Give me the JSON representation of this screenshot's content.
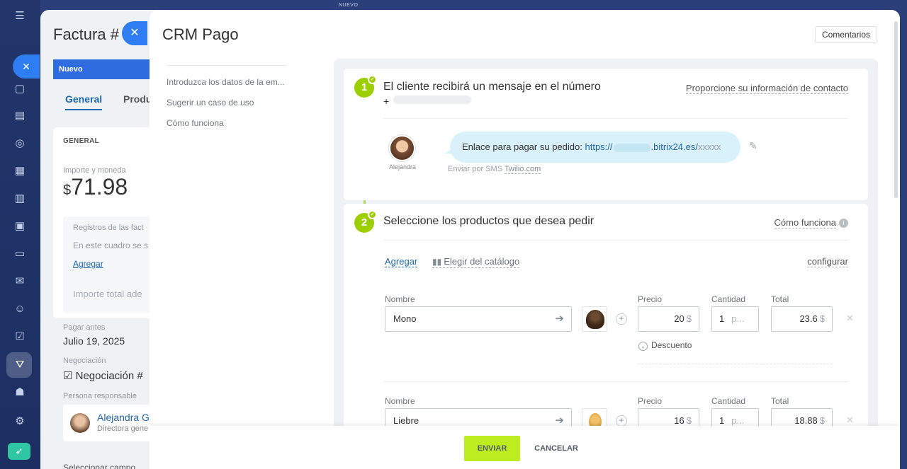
{
  "background": {
    "new_badge": "NUEVO",
    "invoice_title": "Factura #",
    "stage": "Nuevo",
    "tabs": [
      "General",
      "Produ"
    ],
    "card_head": "GENERAL",
    "amount_label": "Importe y moneda",
    "amount_currency": "$",
    "amount_value": "71.98",
    "registers_label": "Registros de las fact",
    "box_text": "En este cuadro se s",
    "add_link": "Agregar",
    "total_label": "Importe total ade",
    "pay_before_label": "Pagar antes",
    "pay_before_value": "Julio 19, 2025",
    "deal_label": "Negociación",
    "deal_value": "Negociación #",
    "responsible_label": "Persona responsable",
    "person_name": "Alejandra G",
    "person_role": "Directora gene",
    "select_field": "Seleccionar campo"
  },
  "slider": {
    "title": "CRM Pago",
    "comments_button": "Comentarios",
    "nav": [
      "Introduzca los datos de la em...",
      "Sugerir un caso de uso",
      "Cómo funciona"
    ]
  },
  "step1": {
    "number": "1",
    "title": "El cliente recibirá un mensaje en el número",
    "phone_prefix": "+",
    "contact_link": "Proporcione su información de contacto",
    "avatar_name": "Alejandra",
    "message_prefix": "Enlace para pagar su pedido:",
    "link_start": "https://",
    "link_domain": ".bitrix24.es/",
    "link_suffix": "xxxxx",
    "sms_prefix": "Enviar por SMS",
    "sms_provider": "Twilio.com"
  },
  "step2": {
    "number": "2",
    "title": "Seleccione los productos que desea pedir",
    "how_link": "Cómo funciona",
    "add_link": "Agregar",
    "catalog_link": "Elegir del catálogo",
    "config_link": "configurar",
    "labels": {
      "name": "Nombre",
      "price": "Precio",
      "qty": "Cantidad",
      "total": "Total"
    },
    "discount_label": "Descuento",
    "products": [
      {
        "name": "Mono",
        "price": "20",
        "currency": "$",
        "qty": "1",
        "unit": "p...",
        "total": "23.6"
      },
      {
        "name": "Liebre",
        "price": "16",
        "currency": "$",
        "qty": "1",
        "unit": "p...",
        "total": "18.88"
      }
    ]
  },
  "footer": {
    "send": "ENVIAR",
    "cancel": "CANCELAR"
  },
  "colors": {
    "accent": "#2f7df2",
    "step": "#9dcf00",
    "send": "#bbed21",
    "link": "#2067b0"
  }
}
